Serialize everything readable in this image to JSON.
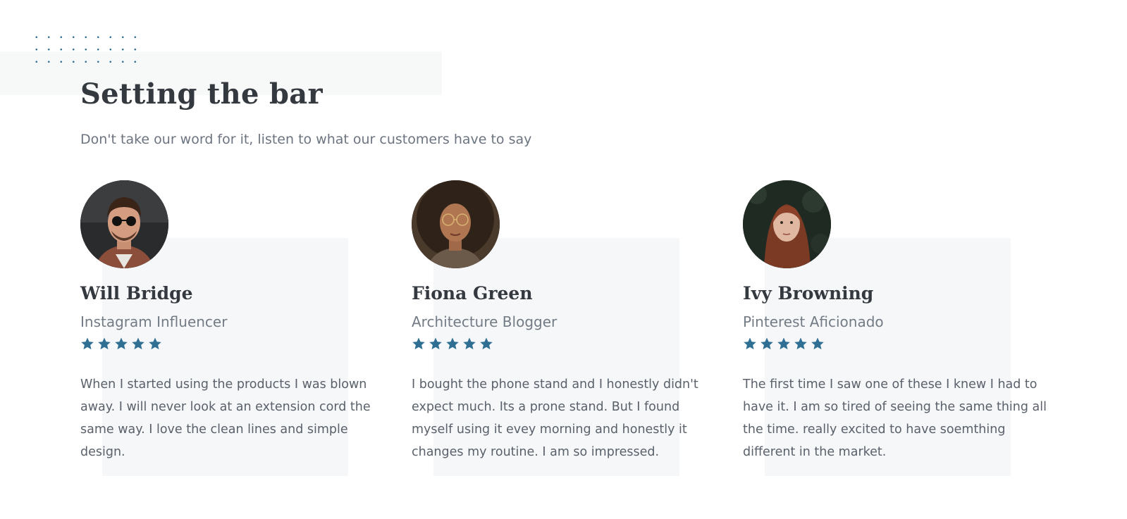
{
  "section": {
    "title": "Setting the bar",
    "subtitle": "Don't take our word for it, listen to what our customers have to say"
  },
  "colors": {
    "star": "#2f6f93",
    "heading": "#34383f",
    "card_bg": "#f5f7f8"
  },
  "testimonials": [
    {
      "name": "Will Bridge",
      "role": "Instagram Influencer",
      "rating": 5,
      "quote": "When I started using the products I was blown away.  I will never look at an extension cord the same way. I love the clean lines and simple design."
    },
    {
      "name": "Fiona Green",
      "role": "Architecture Blogger",
      "rating": 5,
      "quote": "I bought the phone stand and I honestly didn't expect much.  Its a prone stand.  But I found myself using it evey morning and honestly it changes my routine.  I am so impressed."
    },
    {
      "name": "Ivy Browning",
      "role": "Pinterest Aficionado",
      "rating": 5,
      "quote": "The first time I saw one of these I knew I had to have it.  I am so tired of seeing the same thing all the time.  really excited to have soemthing different in the market."
    }
  ]
}
